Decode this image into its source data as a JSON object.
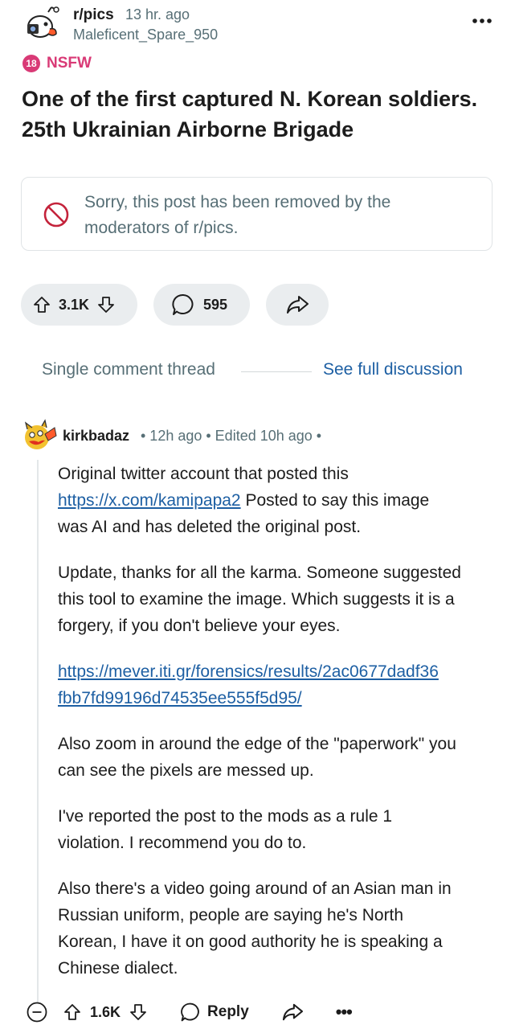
{
  "post": {
    "subreddit": "r/pics",
    "time": "13 hr. ago",
    "author": "Maleficent_Spare_950",
    "more_icon": "overflow-dots-icon",
    "nsfw_badge": "18",
    "nsfw_label": "NSFW",
    "title_lines": [
      "One of the first captured N. Korean soldiers.",
      "25th Ukrainian Airborne Brigade"
    ],
    "removed_notice_lines": [
      "Sorry, this post has been removed by the",
      "moderators of r/pics."
    ],
    "upvotes": "3.1K",
    "comments": "595"
  },
  "thread": {
    "label": "Single comment thread",
    "full_discussion_link": "See full discussion"
  },
  "comment": {
    "author": "kirkbadaz",
    "meta": "• 12h ago • Edited 10h ago •",
    "p1_lines": [
      "Original twitter account that posted this"
    ],
    "p1_link": "https://x.com/kamipapa2",
    "p1_after_link": " Posted to say this image",
    "p1_tail": "was AI and has deleted the original post.",
    "p2_lines": [
      "Update, thanks for all the karma. Someone suggested",
      "this tool to examine the image. Which suggests it is a",
      "forgery, if you don't believe your eyes."
    ],
    "link2_lines": [
      "https://mever.iti.gr/forensics/results/2ac0677dadf36",
      "fbb7fd99196d74535ee555f5d95/"
    ],
    "p3_lines": [
      "Also zoom in around the edge of the \"paperwork\" you",
      "can see the pixels are messed up."
    ],
    "p4_lines": [
      "I've reported the post to the mods as a rule 1",
      "violation. I recommend you do to."
    ],
    "p5_lines": [
      "Also there's a video going around of an Asian man in",
      "Russian uniform, people are saying he's North",
      "Korean, I have it on good authority he is speaking a",
      "Chinese dialect."
    ],
    "votes": "1.6K",
    "reply_label": "Reply",
    "more_label": "•••"
  },
  "colors": {
    "nsfw": "#d93a76",
    "link": "#1d5fa3",
    "muted": "#576f76",
    "pill_bg": "#eaedef"
  }
}
